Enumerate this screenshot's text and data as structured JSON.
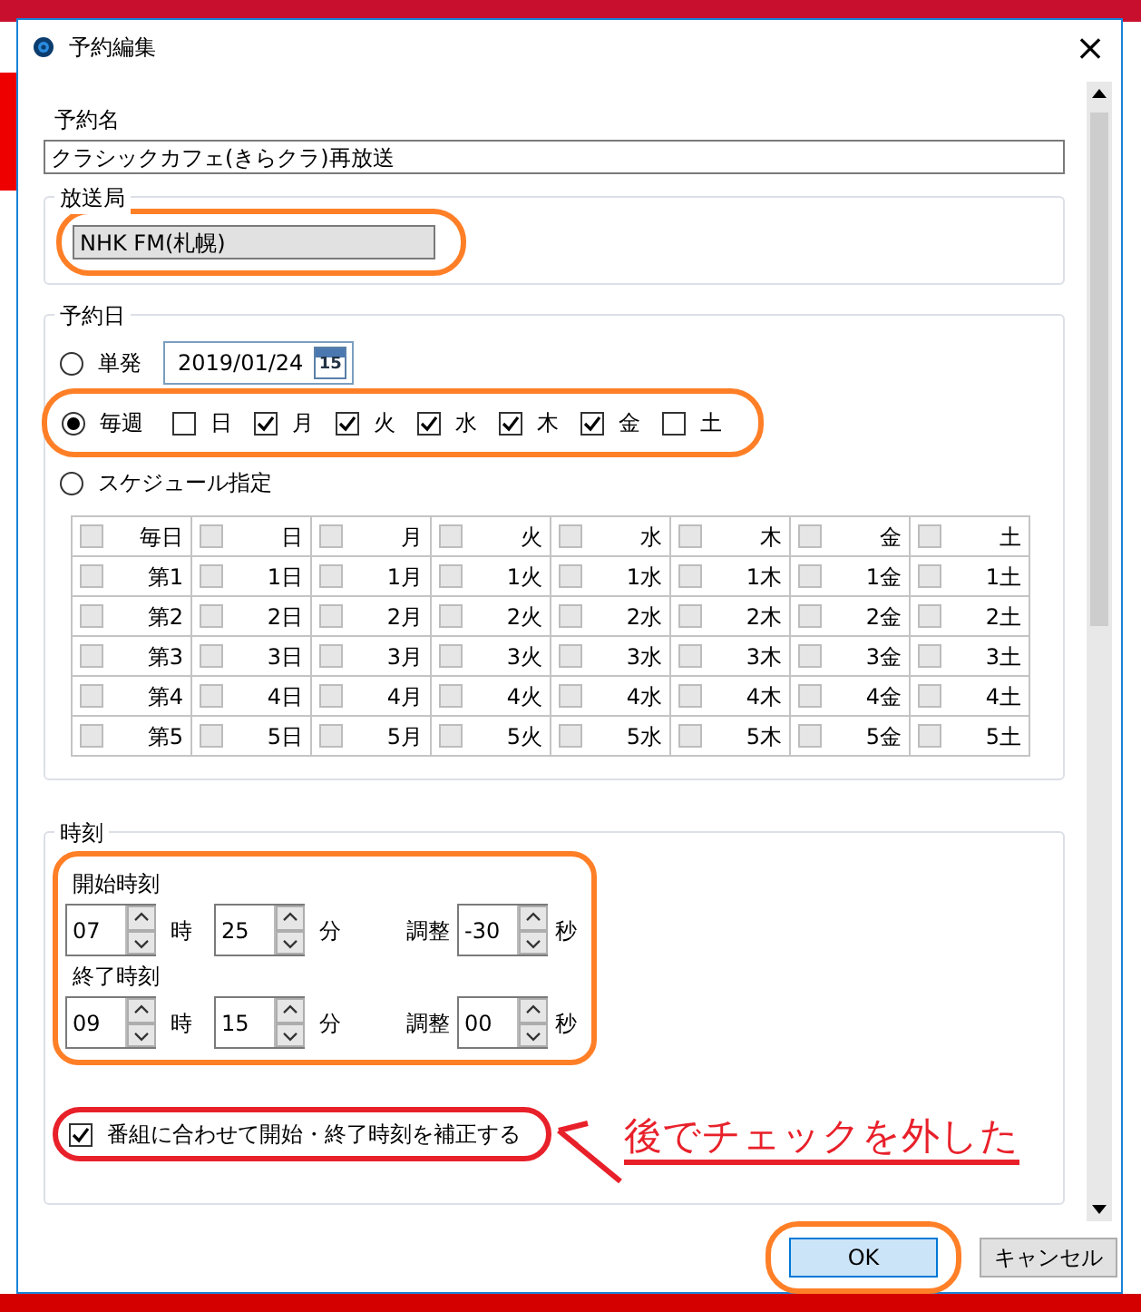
{
  "window": {
    "title": "予約編集",
    "close": "×"
  },
  "reservation_name": {
    "label": "予約名",
    "value": "クラシックカフェ(きらクラ)再放送"
  },
  "station": {
    "label": "放送局",
    "value": "NHK FM(札幌)",
    "highlight": {
      "color": "#ff7f27"
    }
  },
  "date": {
    "label": "予約日",
    "options": [
      {
        "label": "単発",
        "selected": false
      },
      {
        "label": "毎週",
        "selected": true,
        "highlight": {
          "color": "#ff7f27"
        }
      },
      {
        "label": "スケジュール指定",
        "selected": false
      }
    ],
    "single_date": "2019/01/24",
    "calendar_day": "15",
    "weekdays": [
      {
        "label": "日",
        "checked": false
      },
      {
        "label": "月",
        "checked": true
      },
      {
        "label": "火",
        "checked": true
      },
      {
        "label": "水",
        "checked": true
      },
      {
        "label": "木",
        "checked": true
      },
      {
        "label": "金",
        "checked": true
      },
      {
        "label": "土",
        "checked": false
      }
    ],
    "schedule": {
      "disabled": true,
      "rows": [
        [
          {
            "label": "毎日",
            "checked": false
          },
          {
            "label": "日",
            "checked": false
          },
          {
            "label": "月",
            "checked": false
          },
          {
            "label": "火",
            "checked": false
          },
          {
            "label": "水",
            "checked": false
          },
          {
            "label": "木",
            "checked": false
          },
          {
            "label": "金",
            "checked": false
          },
          {
            "label": "土",
            "checked": false
          }
        ],
        [
          {
            "label": "第1",
            "checked": false
          },
          {
            "label": "1日",
            "checked": false
          },
          {
            "label": "1月",
            "checked": false
          },
          {
            "label": "1火",
            "checked": false
          },
          {
            "label": "1水",
            "checked": false
          },
          {
            "label": "1木",
            "checked": false
          },
          {
            "label": "1金",
            "checked": false
          },
          {
            "label": "1土",
            "checked": false
          }
        ],
        [
          {
            "label": "第2",
            "checked": false
          },
          {
            "label": "2日",
            "checked": false
          },
          {
            "label": "2月",
            "checked": false
          },
          {
            "label": "2火",
            "checked": false
          },
          {
            "label": "2水",
            "checked": false
          },
          {
            "label": "2木",
            "checked": false
          },
          {
            "label": "2金",
            "checked": false
          },
          {
            "label": "2土",
            "checked": false
          }
        ],
        [
          {
            "label": "第3",
            "checked": false
          },
          {
            "label": "3日",
            "checked": false
          },
          {
            "label": "3月",
            "checked": false
          },
          {
            "label": "3火",
            "checked": false
          },
          {
            "label": "3水",
            "checked": false
          },
          {
            "label": "3木",
            "checked": false
          },
          {
            "label": "3金",
            "checked": false
          },
          {
            "label": "3土",
            "checked": false
          }
        ],
        [
          {
            "label": "第4",
            "checked": false
          },
          {
            "label": "4日",
            "checked": false
          },
          {
            "label": "4月",
            "checked": false
          },
          {
            "label": "4火",
            "checked": false
          },
          {
            "label": "4水",
            "checked": false
          },
          {
            "label": "4木",
            "checked": false
          },
          {
            "label": "4金",
            "checked": false
          },
          {
            "label": "4土",
            "checked": false
          }
        ],
        [
          {
            "label": "第5",
            "checked": false
          },
          {
            "label": "5日",
            "checked": false
          },
          {
            "label": "5月",
            "checked": false
          },
          {
            "label": "5火",
            "checked": false
          },
          {
            "label": "5水",
            "checked": false
          },
          {
            "label": "5木",
            "checked": false
          },
          {
            "label": "5金",
            "checked": false
          },
          {
            "label": "5土",
            "checked": false
          }
        ]
      ]
    }
  },
  "time": {
    "label": "時刻",
    "highlight": {
      "color": "#ff7f27"
    },
    "rows": [
      {
        "label": "開始時刻",
        "hour": "07",
        "hour_unit": "時",
        "minute": "25",
        "minute_unit": "分",
        "adjust_label": "調整",
        "adjust": "-30",
        "adjust_unit": "秒"
      },
      {
        "label": "終了時刻",
        "hour": "09",
        "hour_unit": "時",
        "minute": "15",
        "minute_unit": "分",
        "adjust_label": "調整",
        "adjust": "00",
        "adjust_unit": "秒"
      }
    ],
    "correction": {
      "label": "番組に合わせて開始・終了時刻を補正する",
      "checked": true,
      "highlight": {
        "color": "#e8202a"
      }
    },
    "note": {
      "text": "後でチェックを外した",
      "color": "#e8202a"
    }
  },
  "buttons": [
    {
      "label": "OK",
      "kind": "default",
      "highlight": {
        "color": "#ff7f27"
      }
    },
    {
      "label": "キャンセル",
      "kind": "normal"
    }
  ]
}
